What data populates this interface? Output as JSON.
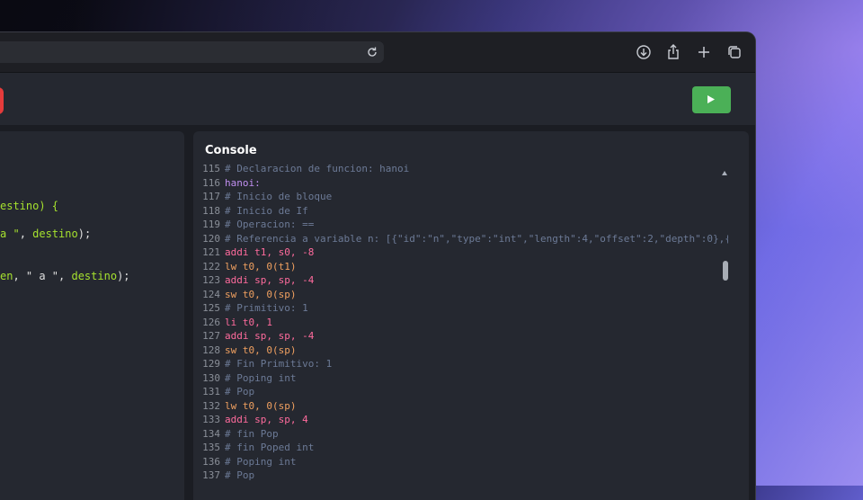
{
  "toolbar": {
    "icons": [
      "reload-icon",
      "download-icon",
      "share-icon",
      "new-tab-icon",
      "tabs-overview-icon"
    ]
  },
  "app": {
    "run_button_icon": "play-icon"
  },
  "editor": {
    "lines": [
      {
        "pre": "estino) {",
        "parts": []
      },
      {
        "pre": "a \"",
        "mid": ", ",
        "var": "destino",
        "post": ");"
      },
      {
        "pre": "en",
        "mid": ", \" a \", ",
        "var": "destino",
        "post": ");"
      }
    ]
  },
  "console": {
    "title": "Console",
    "lines": [
      {
        "n": "115",
        "t": "# Declaracion de funcion: hanoi",
        "k": "comment"
      },
      {
        "n": "116",
        "t": "hanoi:",
        "k": "instr-purple"
      },
      {
        "n": "117",
        "t": "# Inicio de bloque",
        "k": "comment"
      },
      {
        "n": "118",
        "t": "# Inicio de If",
        "k": "comment"
      },
      {
        "n": "119",
        "t": "# Operacion: ==",
        "k": "comment"
      },
      {
        "n": "120",
        "t": "# Referencia a variable n: [{\"id\":\"n\",\"type\":\"int\",\"length\":4,\"offset\":2,\"depth\":0},{\"i",
        "k": "comment"
      },
      {
        "n": "121",
        "t": "addi t1, s0, -8",
        "k": "instr-pink"
      },
      {
        "n": "122",
        "t": "lw t0, 0(t1)",
        "k": "instr-orange"
      },
      {
        "n": "123",
        "t": "addi sp, sp, -4",
        "k": "instr-pink"
      },
      {
        "n": "124",
        "t": "sw t0, 0(sp)",
        "k": "instr-orange"
      },
      {
        "n": "125",
        "t": "# Primitivo: 1",
        "k": "comment"
      },
      {
        "n": "126",
        "t": "li t0, 1",
        "k": "instr-pink"
      },
      {
        "n": "127",
        "t": "addi sp, sp, -4",
        "k": "instr-pink"
      },
      {
        "n": "128",
        "t": "sw t0, 0(sp)",
        "k": "instr-orange"
      },
      {
        "n": "129",
        "t": "# Fin Primitivo: 1",
        "k": "comment"
      },
      {
        "n": "130",
        "t": "# Poping int",
        "k": "comment"
      },
      {
        "n": "131",
        "t": "# Pop",
        "k": "comment"
      },
      {
        "n": "132",
        "t": "lw t0, 0(sp)",
        "k": "instr-orange"
      },
      {
        "n": "133",
        "t": "addi sp, sp, 4",
        "k": "instr-pink"
      },
      {
        "n": "134",
        "t": "# fin Pop",
        "k": "comment"
      },
      {
        "n": "135",
        "t": "# fin Poped int",
        "k": "comment"
      },
      {
        "n": "136",
        "t": "# Poping int",
        "k": "comment"
      },
      {
        "n": "137",
        "t": "# Pop",
        "k": "comment"
      }
    ]
  }
}
